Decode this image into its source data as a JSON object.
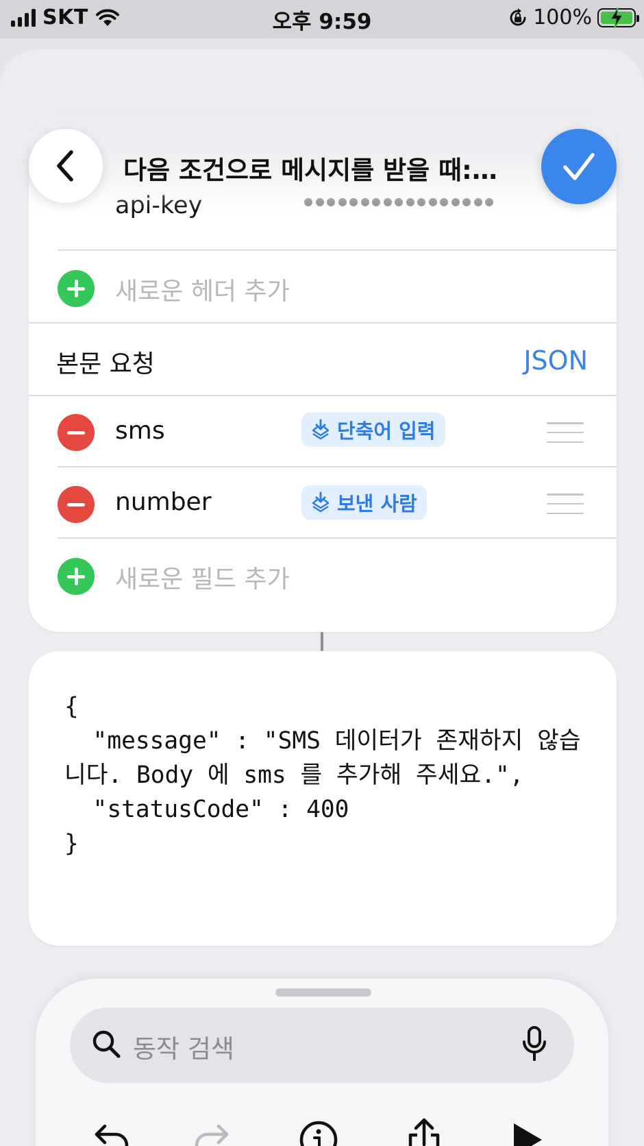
{
  "status_bar": {
    "carrier": "SKT",
    "time": "오후 9:59",
    "battery_percent": "100%",
    "icons": [
      "signal-icon",
      "wifi-icon",
      "orientation-lock-icon",
      "battery-charging-icon"
    ]
  },
  "header": {
    "title": "다음 조건으로 메시지를 받을 때:…",
    "back_icon": "chevron-left-icon",
    "done_icon": "checkmark-icon"
  },
  "headers_section": {
    "key": "api-key",
    "value_masked": "•••••••••••••••",
    "add_label": "새로운 헤더 추가"
  },
  "body_section": {
    "label": "본문 요청",
    "type": "JSON",
    "fields": [
      {
        "name": "sms",
        "value": "단축어 입력",
        "value_icon": "shortcut-input-icon"
      },
      {
        "name": "number",
        "value": "보낸 사람",
        "value_icon": "shortcut-input-icon"
      }
    ],
    "add_label": "새로운 필드 추가"
  },
  "result": {
    "text": "{\n  \"message\" : \"SMS 데이터가 존재하지 않습니다. Body 에 sms 를 추가해 주세요.\",\n  \"statusCode\" : 400\n}"
  },
  "search": {
    "placeholder": "동작 검색",
    "icon": "search-icon",
    "mic_icon": "microphone-icon"
  },
  "toolbar": {
    "buttons": [
      "undo-icon",
      "redo-icon",
      "info-icon",
      "share-icon",
      "play-icon"
    ]
  },
  "colors": {
    "accent": "#3a86ea",
    "add_green": "#35c759",
    "remove_red": "#e5483f",
    "chip_bg": "#e1efff"
  }
}
